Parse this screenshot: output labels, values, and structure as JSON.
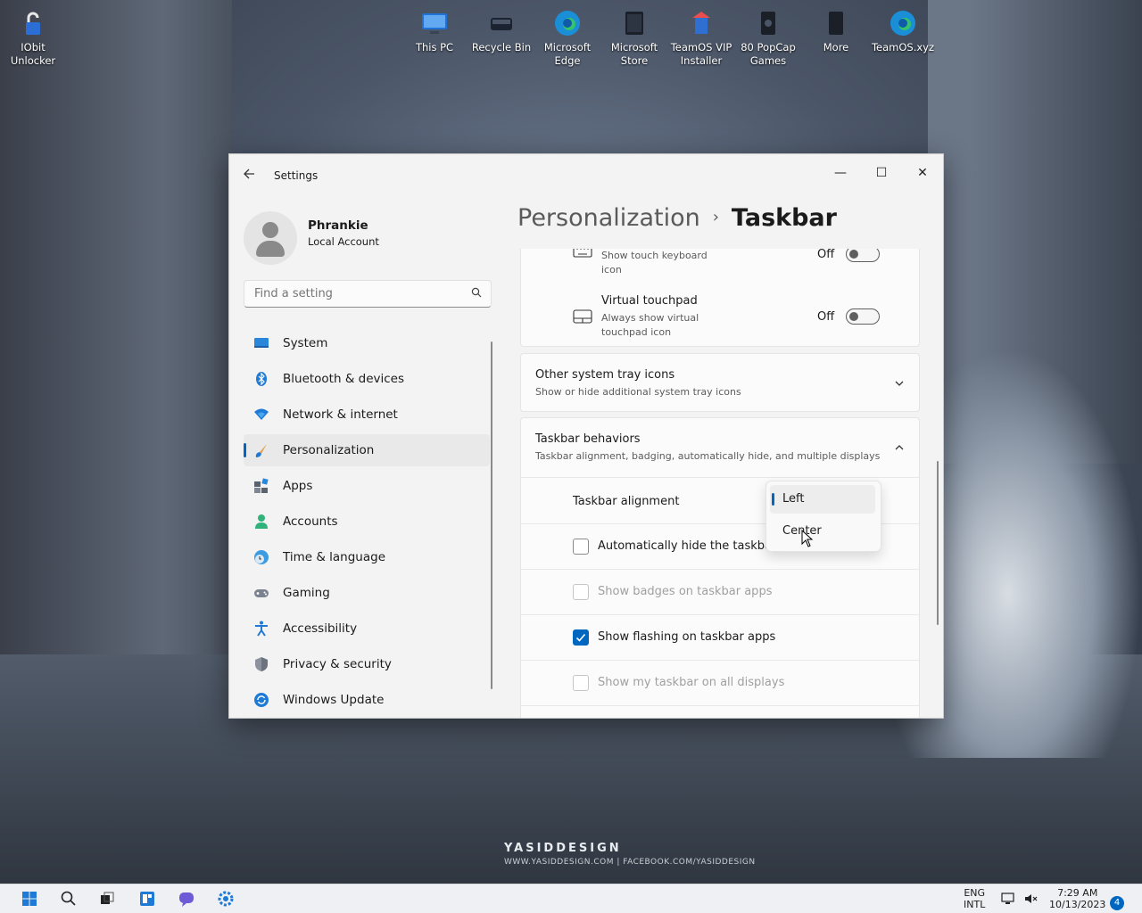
{
  "desktop": {
    "icons": [
      {
        "label": "IObit Unlocker",
        "icon": "unlock-icon"
      },
      {
        "label": "This PC",
        "icon": "monitor-icon"
      },
      {
        "label": "Recycle Bin",
        "icon": "recycle-bin-icon"
      },
      {
        "label": "Microsoft Edge",
        "icon": "edge-icon"
      },
      {
        "label": "Microsoft Store",
        "icon": "store-icon"
      },
      {
        "label": "TeamOS VIP Installer",
        "icon": "installer-icon"
      },
      {
        "label": "80 PopCap Games",
        "icon": "games-icon"
      },
      {
        "label": "More",
        "icon": "more-icon"
      },
      {
        "label": "TeamOS.xyz",
        "icon": "edge-icon"
      }
    ],
    "watermark": "YASIDDESIGN",
    "watermark_sub": "WWW.YASIDDESIGN.COM | FACEBOOK.COM/YASIDDESIGN"
  },
  "window": {
    "title": "Settings",
    "minimize": "—",
    "maximize": "☐",
    "close": "✕"
  },
  "profile": {
    "name": "Phrankie",
    "account_type": "Local Account"
  },
  "search": {
    "placeholder": "Find a setting"
  },
  "nav": {
    "items": [
      {
        "label": "System",
        "icon": "system-icon"
      },
      {
        "label": "Bluetooth & devices",
        "icon": "bluetooth-icon"
      },
      {
        "label": "Network & internet",
        "icon": "wifi-icon"
      },
      {
        "label": "Personalization",
        "icon": "brush-icon",
        "active": true
      },
      {
        "label": "Apps",
        "icon": "apps-icon"
      },
      {
        "label": "Accounts",
        "icon": "accounts-icon"
      },
      {
        "label": "Time & language",
        "icon": "clock-globe-icon"
      },
      {
        "label": "Gaming",
        "icon": "gamepad-icon"
      },
      {
        "label": "Accessibility",
        "icon": "accessibility-icon"
      },
      {
        "label": "Privacy & security",
        "icon": "shield-icon"
      },
      {
        "label": "Windows Update",
        "icon": "update-icon"
      }
    ]
  },
  "breadcrumb": {
    "parent": "Personalization",
    "separator": "›",
    "current": "Taskbar"
  },
  "touch_keyboard": {
    "subtitle_line1": "Show touch keyboard",
    "subtitle_line2": "icon",
    "state": "Off"
  },
  "virtual_touchpad": {
    "title": "Virtual touchpad",
    "subtitle_line1": "Always show virtual",
    "subtitle_line2": "touchpad icon",
    "state": "Off"
  },
  "other_tray": {
    "title": "Other system tray icons",
    "subtitle": "Show or hide additional system tray icons"
  },
  "behaviors": {
    "title": "Taskbar behaviors",
    "subtitle": "Taskbar alignment, badging, automatically hide, and multiple displays",
    "alignment_label": "Taskbar alignment",
    "alignment_options": [
      "Left",
      "Center"
    ],
    "alignment_selected": "Left",
    "auto_hide": {
      "label": "Automatically hide the taskbar",
      "checked": false,
      "enabled": true
    },
    "badges": {
      "label": "Show badges on taskbar apps",
      "checked": false,
      "enabled": false
    },
    "flashing": {
      "label": "Show flashing on taskbar apps",
      "checked": true,
      "enabled": true
    },
    "all_displays": {
      "label": "Show my taskbar on all displays",
      "checked": false,
      "enabled": false
    }
  },
  "taskbar": {
    "language": "ENG",
    "language_sub": "INTL",
    "time": "7:29 AM",
    "date": "10/13/2023",
    "notification_count": "4",
    "accent": "#0067c0"
  }
}
